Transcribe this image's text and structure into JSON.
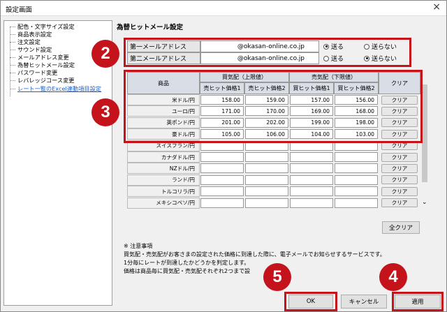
{
  "window": {
    "title": "設定画面",
    "close": "×"
  },
  "tree": {
    "items": [
      "配色・文字サイズ設定",
      "商品表示設定",
      "注文設定",
      "サウンド設定",
      "メールアドレス変更",
      "為替ヒットメール設定",
      "パスワード変更",
      "レバレッジコース変更",
      "レート一覧のExcel連動項目設定"
    ]
  },
  "section_title": "為替ヒットメール設定",
  "email": {
    "rows": [
      {
        "label": "第一メールアドレス",
        "value": "@okasan-online.co.jp",
        "send": "送る",
        "nosend": "送らない",
        "selected": "send"
      },
      {
        "label": "第二メールアドレス",
        "value": "@okasan-online.co.jp",
        "send": "送る",
        "nosend": "送らない",
        "selected": "nosend"
      }
    ]
  },
  "table": {
    "col_product": "商品",
    "group_buy": "買気配（上限値）",
    "group_sell": "売気配（下限値）",
    "col_clear": "クリア",
    "sub": [
      "売ヒット価格1",
      "売ヒット価格2",
      "買ヒット価格1",
      "買ヒット価格2"
    ],
    "rows": [
      {
        "name": "米ドル/円",
        "v": [
          "158.00",
          "159.00",
          "157.00",
          "156.00"
        ],
        "clear": "クリア"
      },
      {
        "name": "ユーロ/円",
        "v": [
          "171.00",
          "170.00",
          "169.00",
          "168.00"
        ],
        "clear": "クリア"
      },
      {
        "name": "英ポンド/円",
        "v": [
          "201.00",
          "202.00",
          "199.00",
          "198.00"
        ],
        "clear": "クリア"
      },
      {
        "name": "豪ドル/円",
        "v": [
          "105.00",
          "106.00",
          "104.00",
          "103.00"
        ],
        "clear": "クリア"
      },
      {
        "name": "スイスフラン/円",
        "v": [
          "",
          "",
          "",
          ""
        ],
        "clear": "クリア"
      },
      {
        "name": "カナダドル/円",
        "v": [
          "",
          "",
          "",
          ""
        ],
        "clear": "クリア"
      },
      {
        "name": "NZドル/円",
        "v": [
          "",
          "",
          "",
          ""
        ],
        "clear": "クリア"
      },
      {
        "name": "ランド/円",
        "v": [
          "",
          "",
          "",
          ""
        ],
        "clear": "クリア"
      },
      {
        "name": "トルコリラ/円",
        "v": [
          "",
          "",
          "",
          ""
        ],
        "clear": "クリア"
      },
      {
        "name": "メキシコペソ/円",
        "v": [
          "",
          "",
          "",
          ""
        ],
        "clear": "クリア"
      }
    ],
    "clear_all": "全クリア"
  },
  "notes": {
    "title": "※ 注意事項",
    "lines": [
      "買気配・売気配がお客さまの設定された価格に到達した際に、電子メールでお知らせするサービスです。",
      "1分毎にレートが到達したかどうかを判定します。",
      "価格は商品毎に買気配・売気配それぞれ2つまで設"
    ]
  },
  "buttons": {
    "ok": "OK",
    "cancel": "キャンセル",
    "apply": "適用"
  },
  "badges": {
    "b2": "2",
    "b3": "3",
    "b4": "4",
    "b5": "5"
  },
  "colors": {
    "highlight": "#c4131b",
    "link": "#1a5fd6"
  }
}
